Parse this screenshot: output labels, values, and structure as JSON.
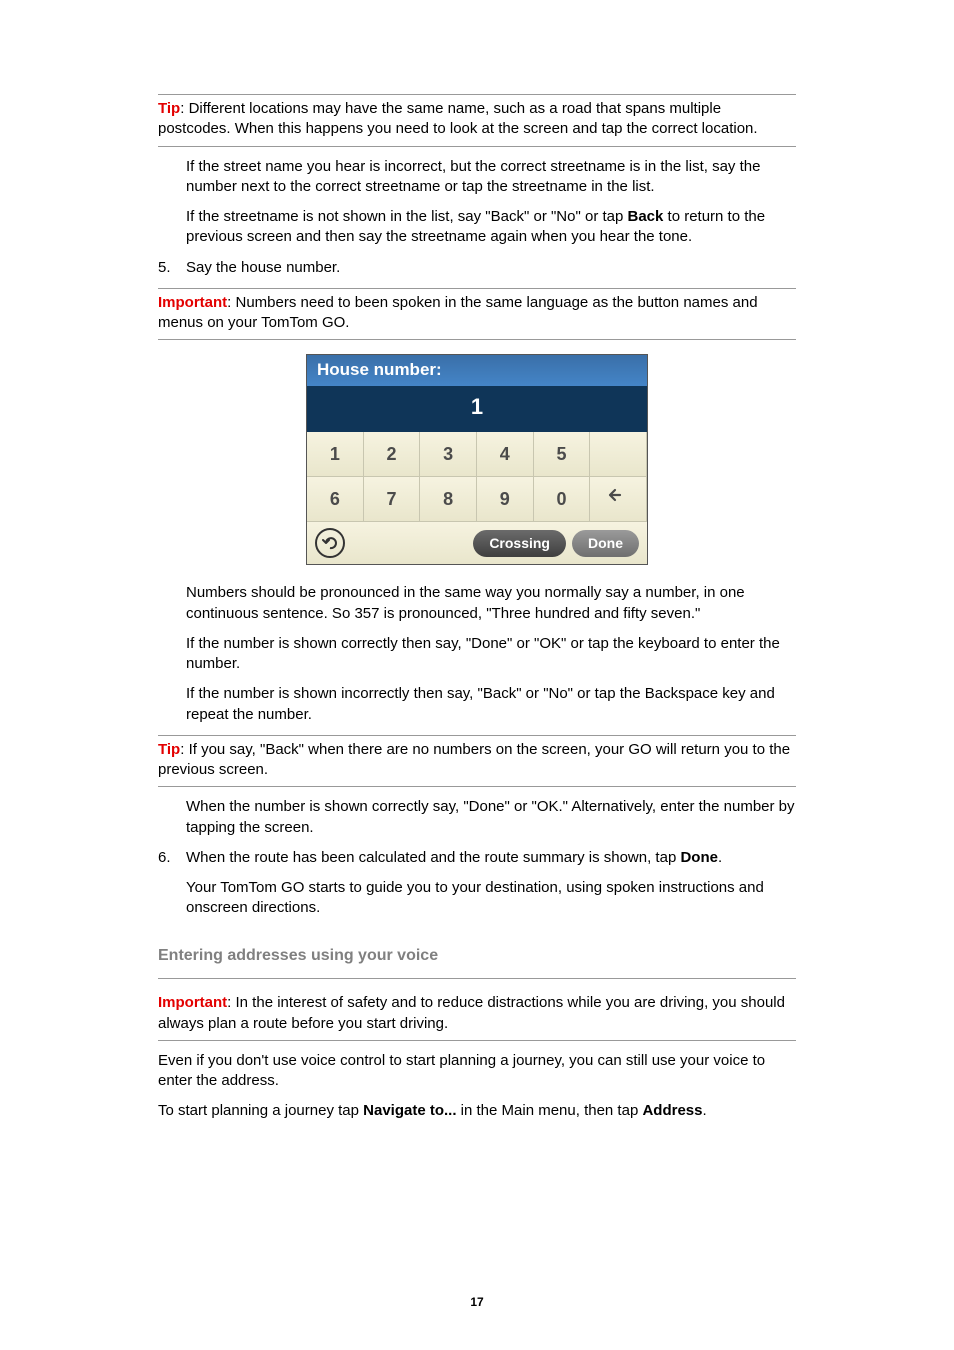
{
  "callouts": {
    "tip1": {
      "label": "Tip",
      "text": ": Different locations may have the same name, such as a road that spans multiple postcodes. When this happens you need to look at the screen and tap the correct location."
    },
    "important1": {
      "label": "Important",
      "text": ": Numbers need to been spoken in the same language as the button names and menus on your TomTom GO."
    },
    "tip2": {
      "label": "Tip",
      "text": ": If you say, \"Back\" when there are no numbers on the screen, your GO will return you to the previous screen."
    },
    "important2": {
      "label": "Important",
      "text": ": In the interest of safety and to reduce distractions while you are driving, you should always plan a route before you start driving."
    }
  },
  "paras": {
    "streetInList": "If the street name you hear is incorrect, but the correct streetname is in the list, say the number next to the correct streetname or tap the streetname in the list.",
    "streetNotInList_a": "If the streetname is not shown in the list, say \"Back\" or \"No\" or tap ",
    "streetNotInList_bold": "Back",
    "streetNotInList_b": " to return to the previous screen and then say the streetname again when you hear the tone.",
    "numbersPronounce": "Numbers should be pronounced in the same way you normally say a number, in one continuous sentence. So 357 is pronounced, \"Three hundred and fifty seven.\"",
    "numberCorrect": "If the number is shown correctly then say, \"Done\" or \"OK\" or tap the keyboard to enter the number.",
    "numberIncorrect": "If the number is shown incorrectly then say, \"Back\" or \"No\" or tap the Backspace key and repeat the number.",
    "numberDone": "When the number is shown correctly say, \"Done\" or \"OK.\" Alternatively, enter the number by tapping the screen.",
    "goGuides": "Your TomTom GO starts to guide you to your destination, using spoken instructions and onscreen directions.",
    "evenIf": "Even if you don't use voice control to start planning a journey, you can still use your voice to enter the address.",
    "startPlanning_a": "To start planning a journey tap ",
    "startPlanning_bold1": "Navigate to...",
    "startPlanning_b": " in the Main menu, then tap ",
    "startPlanning_bold2": "Address",
    "startPlanning_c": "."
  },
  "steps": {
    "s5_num": "5.",
    "s5_text": "Say the house number.",
    "s6_num": "6.",
    "s6_text_a": "When the route has been calculated and the route summary is shown, tap ",
    "s6_bold": "Done",
    "s6_text_b": "."
  },
  "section_heading": "Entering addresses using your voice",
  "page_number": "17",
  "screenshot": {
    "title": "House number:",
    "display_value": "1",
    "keys_row1": [
      "1",
      "2",
      "3",
      "4",
      "5",
      ""
    ],
    "keys_row2": [
      "6",
      "7",
      "8",
      "9",
      "0"
    ],
    "backspace_icon": "backspace-icon",
    "back_icon": "back-arrow-icon",
    "crossing_label": "Crossing",
    "done_label": "Done"
  }
}
